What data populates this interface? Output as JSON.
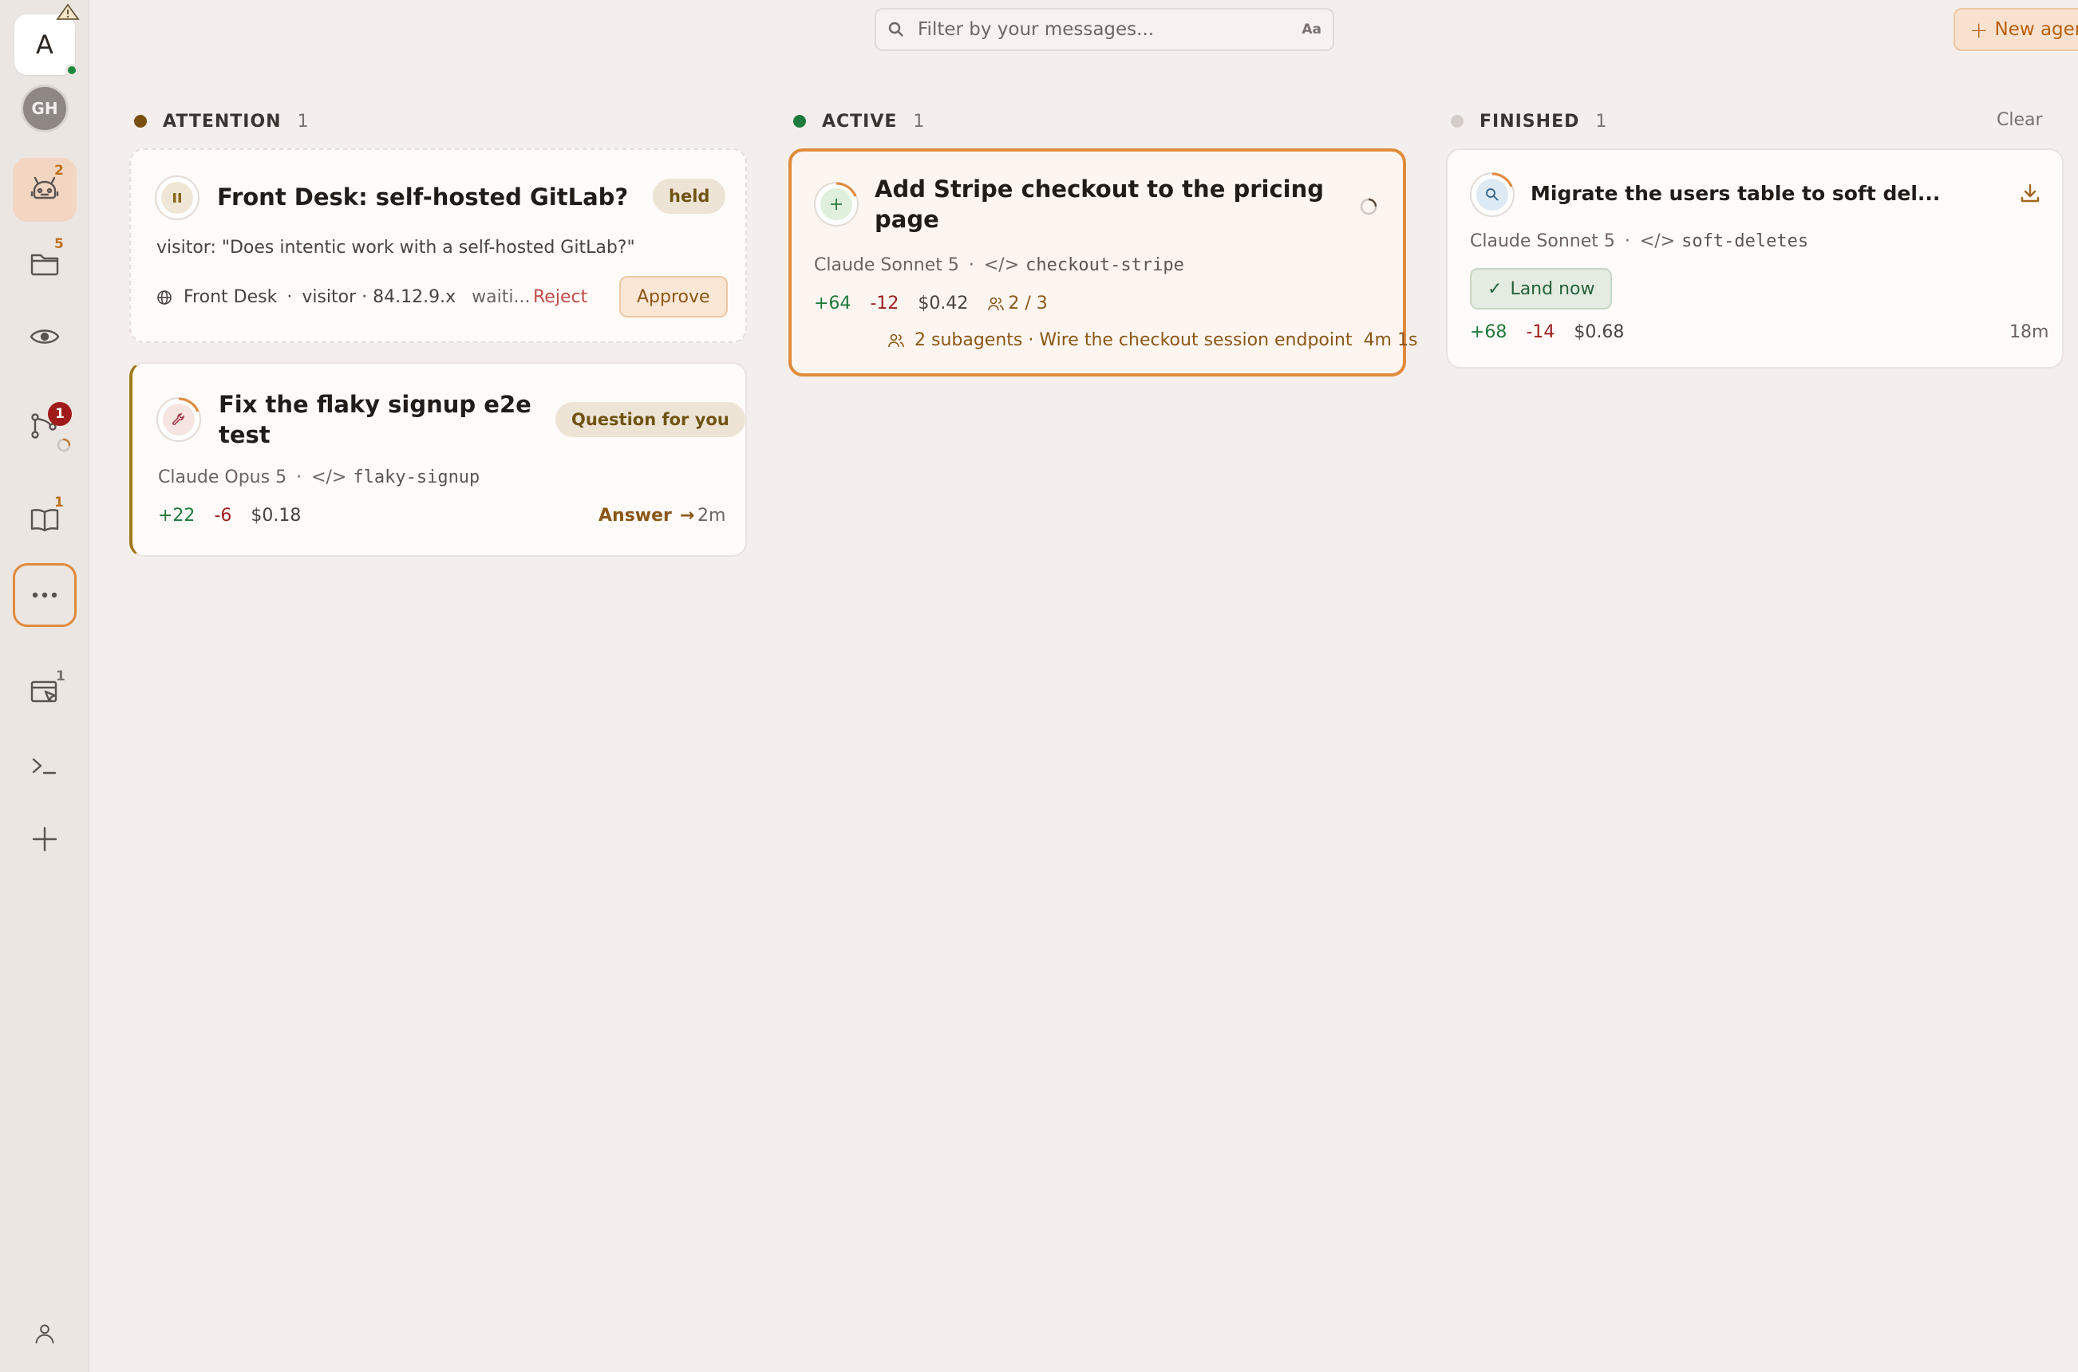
{
  "sidebar": {
    "workspace_initial": "A",
    "avatar_initials": "GH",
    "agents_badge": "2",
    "projects_badge": "5",
    "reviews_badge": "1",
    "docs_badge": "1",
    "browser_badge": "1"
  },
  "search": {
    "placeholder": "Filter by your messages...",
    "case_toggle": "Aa"
  },
  "new_agent_label": "New agent",
  "columns": {
    "attention": {
      "label": "ATTENTION",
      "count": "1",
      "color": "#7a4f0f"
    },
    "active": {
      "label": "ACTIVE",
      "count": "1",
      "color": "#1f7a3d"
    },
    "finished": {
      "label": "FINISHED",
      "count": "1",
      "color": "#d5ccc8",
      "clear_label": "Clear"
    }
  },
  "cards": {
    "front_desk": {
      "title": "Front Desk: self-hosted GitLab?",
      "status": "held",
      "message": "visitor: \"Does intentic work with a self-hosted GitLab?\"",
      "source": "Front Desk",
      "visitor": "visitor · 84.12.9.x",
      "state": "waiti...",
      "reject_label": "Reject",
      "approve_label": "Approve"
    },
    "flaky": {
      "title_line1": "Fix the flaky signup e2e",
      "title_line2": "test",
      "status": "Question for you",
      "model": "Claude Opus 5",
      "branch": "flaky-signup",
      "additions": "+22",
      "deletions": "-6",
      "cost": "$0.18",
      "answer_label": "Answer",
      "time": "2m"
    },
    "stripe": {
      "title_line1": "Add Stripe checkout to the pricing",
      "title_line2": "page",
      "model": "Claude Sonnet 5",
      "branch": "checkout-stripe",
      "additions": "+64",
      "deletions": "-12",
      "cost": "$0.42",
      "subagents_ratio": "2 / 3",
      "subagents_text": "2 subagents · Wire the checkout session endpoint",
      "subagents_time": "4m 1s"
    },
    "migrate": {
      "title": "Migrate the users table to soft del...",
      "model": "Claude Sonnet 5",
      "branch": "soft-deletes",
      "land_label": "Land now",
      "additions": "+68",
      "deletions": "-14",
      "cost": "$0.68",
      "time": "18m"
    }
  },
  "colors": {
    "accent": "#e08a3c",
    "background": "#f4efec",
    "sidebar": "#ece6e2",
    "danger": "#a11a1a"
  }
}
